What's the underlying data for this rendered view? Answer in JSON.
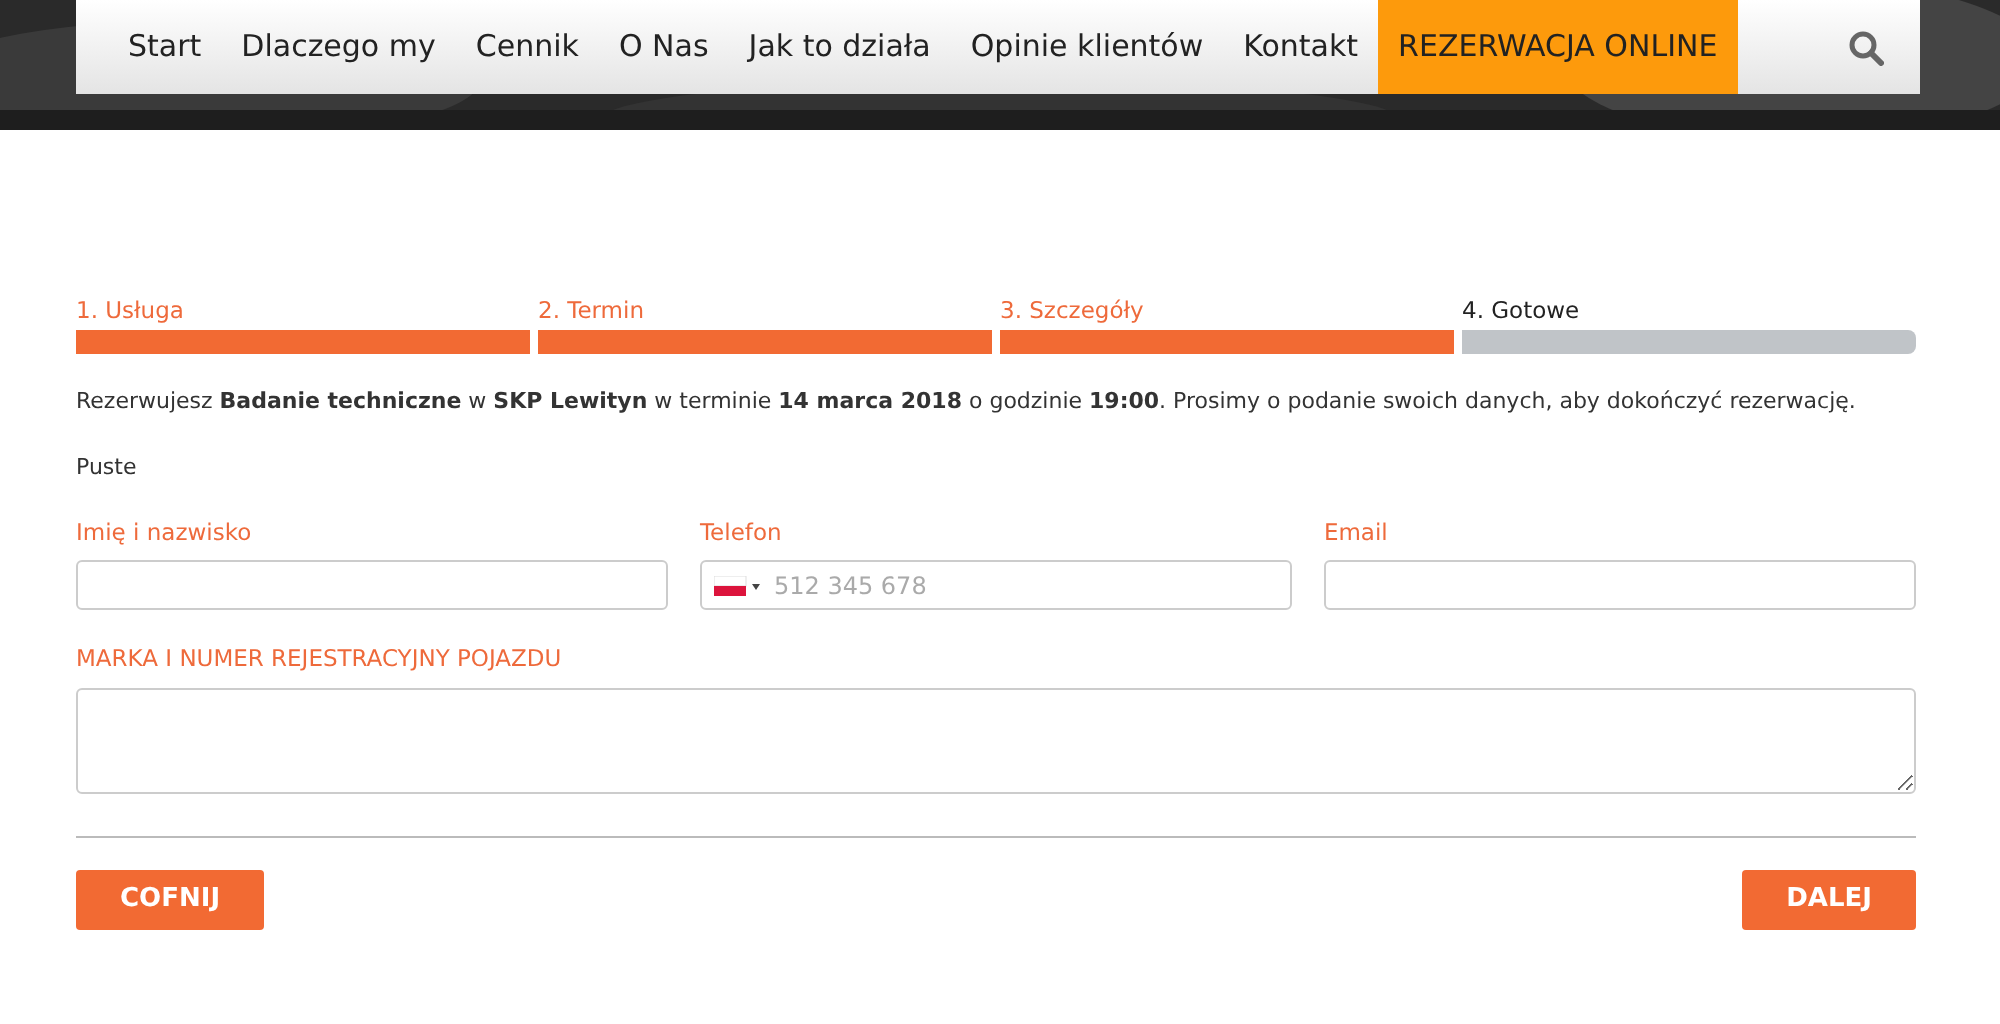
{
  "nav": {
    "items": [
      {
        "label": "Start",
        "selected": false
      },
      {
        "label": "Dlaczego my",
        "selected": false
      },
      {
        "label": "Cennik",
        "selected": false
      },
      {
        "label": "O Nas",
        "selected": false
      },
      {
        "label": "Jak to działa",
        "selected": false
      },
      {
        "label": "Opinie klientów",
        "selected": false
      },
      {
        "label": "Kontakt",
        "selected": false
      },
      {
        "label": "REZERWACJA ONLINE",
        "selected": true
      }
    ]
  },
  "steps": [
    {
      "label": "1. Usługa",
      "done": true
    },
    {
      "label": "2. Termin",
      "done": true
    },
    {
      "label": "3. Szczegóły",
      "done": true
    },
    {
      "label": "4. Gotowe",
      "done": false
    }
  ],
  "summary": "Rezerwujesz **Badanie techniczne** w **SKP Lewityn** w terminie **14 marca 2018** o godzinie **19:00**. Prosimy o podanie swoich danych, aby dokończyć rezerwację.",
  "note": "Puste",
  "fields": [
    {
      "kind": "text",
      "label": "Imię i nazwisko"
    },
    {
      "kind": "phone",
      "label": "Telefon",
      "placeholder": "512 345 678"
    },
    {
      "kind": "text",
      "label": "Email"
    }
  ],
  "vehicle_field": {
    "label": "MARKA I NUMER REJESTRACYJNY POJAZDU"
  },
  "buttons": {
    "back": "COFNIJ",
    "next": "DALEJ"
  }
}
